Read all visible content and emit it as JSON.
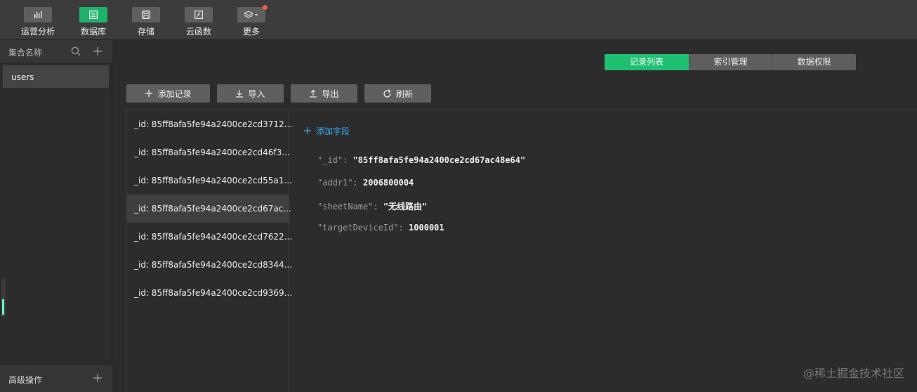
{
  "toolbar": {
    "items": [
      {
        "label": "运营分析",
        "icon": "bar-chart-icon"
      },
      {
        "label": "数据库",
        "icon": "database-icon"
      },
      {
        "label": "存储",
        "icon": "save-icon"
      },
      {
        "label": "云函数",
        "icon": "function-icon"
      },
      {
        "label": "更多",
        "icon": "layers-icon"
      }
    ]
  },
  "sidebar": {
    "header": "集合名称",
    "collections": [
      "users"
    ],
    "footer": "高级操作",
    "level": 0.4
  },
  "tabs": [
    "记录列表",
    "索引管理",
    "数据权限"
  ],
  "actions": {
    "add": "添加记录",
    "import": "导入",
    "export": "导出",
    "refresh": "刷新"
  },
  "records": [
    "_id: 85ff8afa5fe94a2400ce2cd3712...",
    "_id: 85ff8afa5fe94a2400ce2cd46f3...",
    "_id: 85ff8afa5fe94a2400ce2cd55a1...",
    "_id: 85ff8afa5fe94a2400ce2cd67ac...",
    "_id: 85ff8afa5fe94a2400ce2cd7622...",
    "_id: 85ff8afa5fe94a2400ce2cd8344...",
    "_id: 85ff8afa5fe94a2400ce2cd9369..."
  ],
  "detail": {
    "add_field": "添加字段",
    "fields": [
      {
        "key": "\"_id\"",
        "value": "\"85ff8afa5fe94a2400ce2cd67ac48e64\""
      },
      {
        "key": "\"addr1\"",
        "value": "2006800004"
      },
      {
        "key": "\"sheetName\"",
        "value": "\"无线路由\""
      },
      {
        "key": "\"targetDeviceId\"",
        "value": "1000001"
      }
    ]
  },
  "watermark": "@稀土掘金技术社区",
  "colors": {
    "accent": "#1fc072",
    "link": "#3aa8f0",
    "badge": "#f25a4a"
  }
}
